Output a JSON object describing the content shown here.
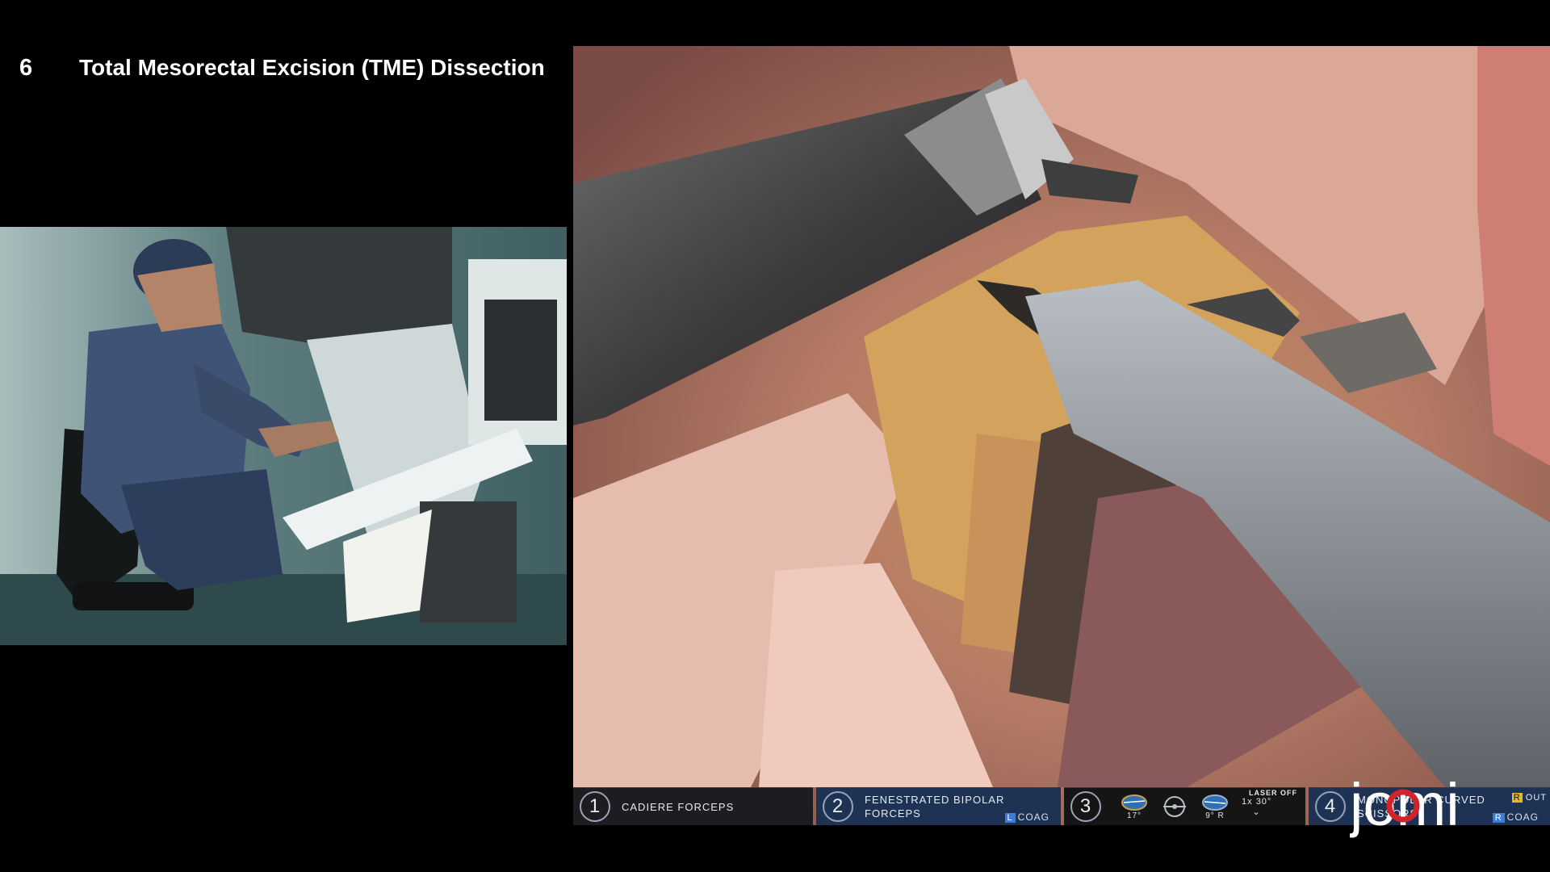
{
  "chapter": {
    "number": "6",
    "title": "Total Mesorectal Excision (TME) Dissection"
  },
  "instruments": [
    {
      "slot": "1",
      "name_line1": "CADIERE FORCEPS",
      "name_line2": "",
      "energy": ""
    },
    {
      "slot": "2",
      "name_line1": "FENESTRATED BIPOLAR",
      "name_line2": "FORCEPS",
      "energy_tag": "L",
      "energy": "COAG"
    },
    {
      "slot": "3",
      "cam_left_angle": "17°",
      "cam_right_angle": "9° R",
      "zoom": "1x",
      "scope_angle": "30°",
      "laser_status": "LASER OFF"
    },
    {
      "slot": "4",
      "name_line1": "MONOPOLAR CURVED",
      "name_line2": "SCISSORS",
      "out_label": "OUT",
      "out_tag": "R",
      "energy_tag": "R",
      "energy": "COAG"
    }
  ],
  "logo": {
    "text": "jomi"
  },
  "colors": {
    "instrument_blue": "#1e3254",
    "energy_blue": "#3e7bd6",
    "logo_red": "#d2232a"
  }
}
